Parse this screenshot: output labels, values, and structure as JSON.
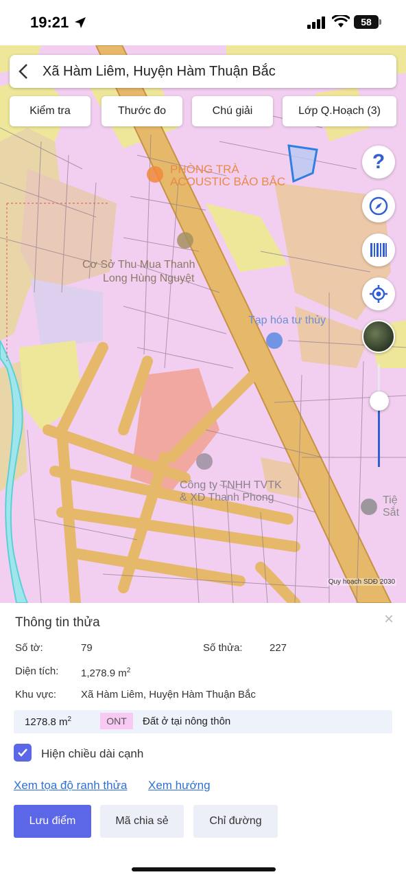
{
  "status": {
    "time": "19:21",
    "battery": "58"
  },
  "search": {
    "title": "Xã Hàm Liêm, Huyện Hàm Thuận Bắc"
  },
  "toolbar": {
    "check": "Kiểm tra",
    "measure": "Thước đo",
    "legend": "Chú giải",
    "layers": "Lớp Q.Hoạch (3)"
  },
  "map": {
    "labels": {
      "tea_1": "PHÒNG TRÀ",
      "tea_2": "ACOUSTIC BẢO BẮC",
      "shop_1": "Cơ Sở Thu Mua Thanh",
      "shop_2": "Long Hùng Nguyệt",
      "grocery": "Tạp hóa tư thủy",
      "company_1": "Công ty TNHH TVTK",
      "company_2": "& XD Thanh Phong",
      "edge_1": "Tiệ",
      "edge_2": "Sắt"
    },
    "credit": "Quy hoạch SDĐ 2030",
    "zoom_level": 0.55
  },
  "fab": {
    "help": "?"
  },
  "panel": {
    "title": "Thông tin thửa",
    "sheet_label": "Số tờ:",
    "sheet_value": "79",
    "parcel_label": "Số thửa:",
    "parcel_value": "227",
    "area_label": "Diện tích:",
    "area_value": "1,278.9 m",
    "area_unit_sup": "2",
    "region_label": "Khu vực:",
    "region_value": "Xã Hàm Liêm, Huyện Hàm Thuận Bắc",
    "land": {
      "area": "1278.8 m",
      "area_sup": "2",
      "code": "ONT",
      "type": "Đất ở tại nông thôn"
    },
    "show_edges": "Hiện chiều dài cạnh",
    "link_coords": "Xem tọa độ ranh thửa",
    "link_direction": "Xem hướng",
    "btn_save": "Lưu điểm",
    "btn_share": "Mã chia sẻ",
    "btn_directions": "Chỉ đường",
    "close": "×"
  },
  "colors": {
    "residential": "#f2cff0",
    "agri": "#f0e49a",
    "road": "#e6b86a",
    "selected": "#2f7ee0",
    "primary": "#5b67e6"
  }
}
